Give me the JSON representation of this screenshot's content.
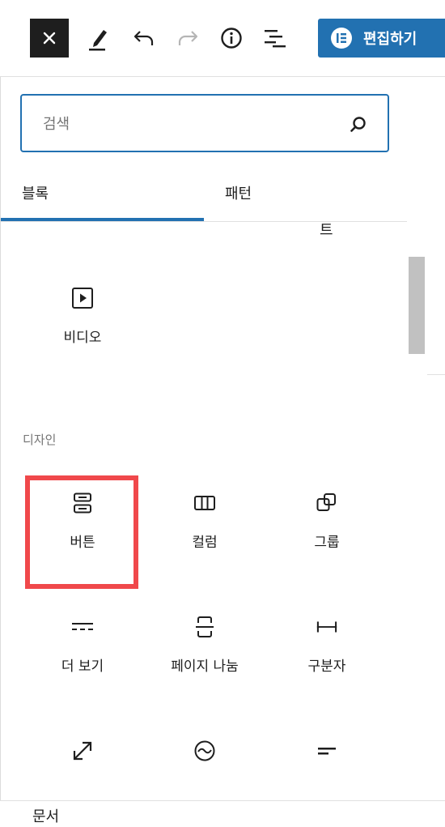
{
  "toolbar": {
    "close": "close",
    "edit_button_label": "편집하기"
  },
  "search": {
    "placeholder": "검색"
  },
  "tabs": [
    {
      "label": "블록",
      "active": true
    },
    {
      "label": "패턴",
      "active": false
    }
  ],
  "block_list": {
    "cut_off_label": "트",
    "media_items": [
      {
        "label": "비디오",
        "icon": "video-icon"
      }
    ],
    "design_section_title": "디자인",
    "design_items": [
      {
        "label": "버튼",
        "icon": "buttons-icon"
      },
      {
        "label": "컬럼",
        "icon": "columns-icon"
      },
      {
        "label": "그룹",
        "icon": "group-icon"
      },
      {
        "label": "더 보기",
        "icon": "more-icon"
      },
      {
        "label": "페이지 나눔",
        "icon": "page-break-icon"
      },
      {
        "label": "구분자",
        "icon": "separator-icon"
      },
      {
        "label": "",
        "icon": "expand-icon"
      },
      {
        "label": "",
        "icon": "text-icon"
      },
      {
        "label": "",
        "icon": "line-icon"
      }
    ]
  },
  "footer": {
    "label": "문서"
  },
  "colors": {
    "accent": "#2271b1",
    "highlight": "#f0484b",
    "dark": "#1e1e1e"
  }
}
